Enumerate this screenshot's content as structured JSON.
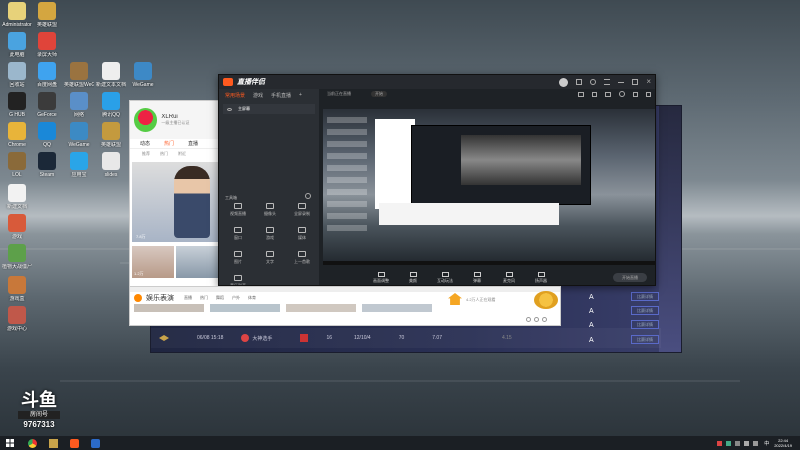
{
  "desktop": {
    "icons": [
      {
        "label": "Administrator",
        "color": "#e7d27a"
      },
      {
        "label": "英雄联盟",
        "color": "#d4a640"
      },
      {
        "label": "此电脑",
        "color": "#4aa3e0"
      },
      {
        "label": "录屏大师",
        "color": "#e0443a"
      },
      {
        "label": "回收站",
        "color": "#9bb7cc"
      },
      {
        "label": "百度网盘",
        "color": "#3fa3ef"
      },
      {
        "label": "英雄联盟WeGame版",
        "color": "#9a7340"
      },
      {
        "label": "新建文本文档",
        "color": "#eeeeee"
      },
      {
        "label": "WeGame",
        "color": "#3d89c6"
      },
      {
        "label": "G HUB",
        "color": "#222222"
      },
      {
        "label": "GeForce",
        "color": "#3b3b3b"
      },
      {
        "label": "网络",
        "color": "#5a8fc8"
      },
      {
        "label": "腾讯QQ",
        "color": "#2aa0e8"
      },
      {
        "label": "Chrome",
        "color": "#e8b43a"
      },
      {
        "label": "QQ",
        "color": "#1a88d8"
      },
      {
        "label": "WeGame",
        "color": "#3c8ac4"
      },
      {
        "label": "英雄联盟",
        "color": "#c49a3e"
      },
      {
        "label": "LOL",
        "color": "#8a6a3a"
      },
      {
        "label": "Steam",
        "color": "#1b2838"
      },
      {
        "label": "应用宝",
        "color": "#2aa5e8"
      },
      {
        "label": "slides",
        "color": "#e8e8e8"
      },
      {
        "label": "新建文档",
        "color": "#f2f2f2"
      },
      {
        "label": "游戏",
        "color": "#d85a3a"
      },
      {
        "label": "植物大战僵尸",
        "color": "#5da04a"
      },
      {
        "label": "游戏盒",
        "color": "#c8783a"
      },
      {
        "label": "游戏中心",
        "color": "#c0584a"
      }
    ]
  },
  "douyu": {
    "brand": "斗鱼",
    "room_label": "房间号",
    "room_id": "9767313"
  },
  "streamer_window": {
    "title": "直播伴侣",
    "tabs": [
      "常用场景",
      "游戏",
      "手机直播",
      "+"
    ],
    "scene_label": "主屏幕",
    "tools": [
      {
        "label": "视频直播",
        "icon": "camera-icon"
      },
      {
        "label": "摄像头",
        "icon": "webcam-icon"
      },
      {
        "label": "全屏录制",
        "icon": "screen-icon"
      },
      {
        "label": "窗口",
        "icon": "window-icon"
      },
      {
        "label": "游戏",
        "icon": "game-icon"
      },
      {
        "label": "媒体",
        "icon": "media-icon"
      },
      {
        "label": "图片",
        "icon": "image-icon"
      },
      {
        "label": "文字",
        "icon": "text-icon"
      }
    ],
    "section_label": "工具箱",
    "bottom_tools": [
      {
        "label": "上一首歌"
      },
      {
        "label": "音乐列表"
      }
    ],
    "top_info": "当前正在直播",
    "preview_btn": "开始",
    "bottom_controls": [
      "画面调整",
      "美颜",
      "互动玩法",
      "弹幕",
      "麦克风",
      "扬声器"
    ],
    "start_btn": "开始直播"
  },
  "chat_window": {
    "user": "XLRui",
    "subtitle": "一级主播已认证",
    "tabs": [
      "动态",
      "热门",
      "直播"
    ],
    "sub_tabs": [
      "推荐",
      "热门",
      "附近"
    ],
    "card_caption": "7.8万",
    "card2_caption": "1.2万"
  },
  "web_window": {
    "brand": "娱乐表演",
    "nav": [
      "直播",
      "热门",
      "舞蹈",
      "户外",
      "体育"
    ],
    "text_line": "4.2万人正在观看"
  },
  "back_panel": {
    "rows": [
      {
        "date": "06/08 15:18",
        "name": "大神选手",
        "score": "16",
        "kda": "12/10/4",
        "val1": "70",
        "val2": "7.07",
        "val3": "4.15"
      }
    ],
    "side_btns": [
      "比赛详情",
      "比赛详情",
      "比赛详情",
      "比赛详情"
    ]
  },
  "taskbar": {
    "time": "22:44",
    "date": "2022/4/19",
    "lang": "中"
  },
  "colors": {
    "accent": "#ff5a1f",
    "dark": "#1e2226",
    "panel": "#2b2f34"
  }
}
